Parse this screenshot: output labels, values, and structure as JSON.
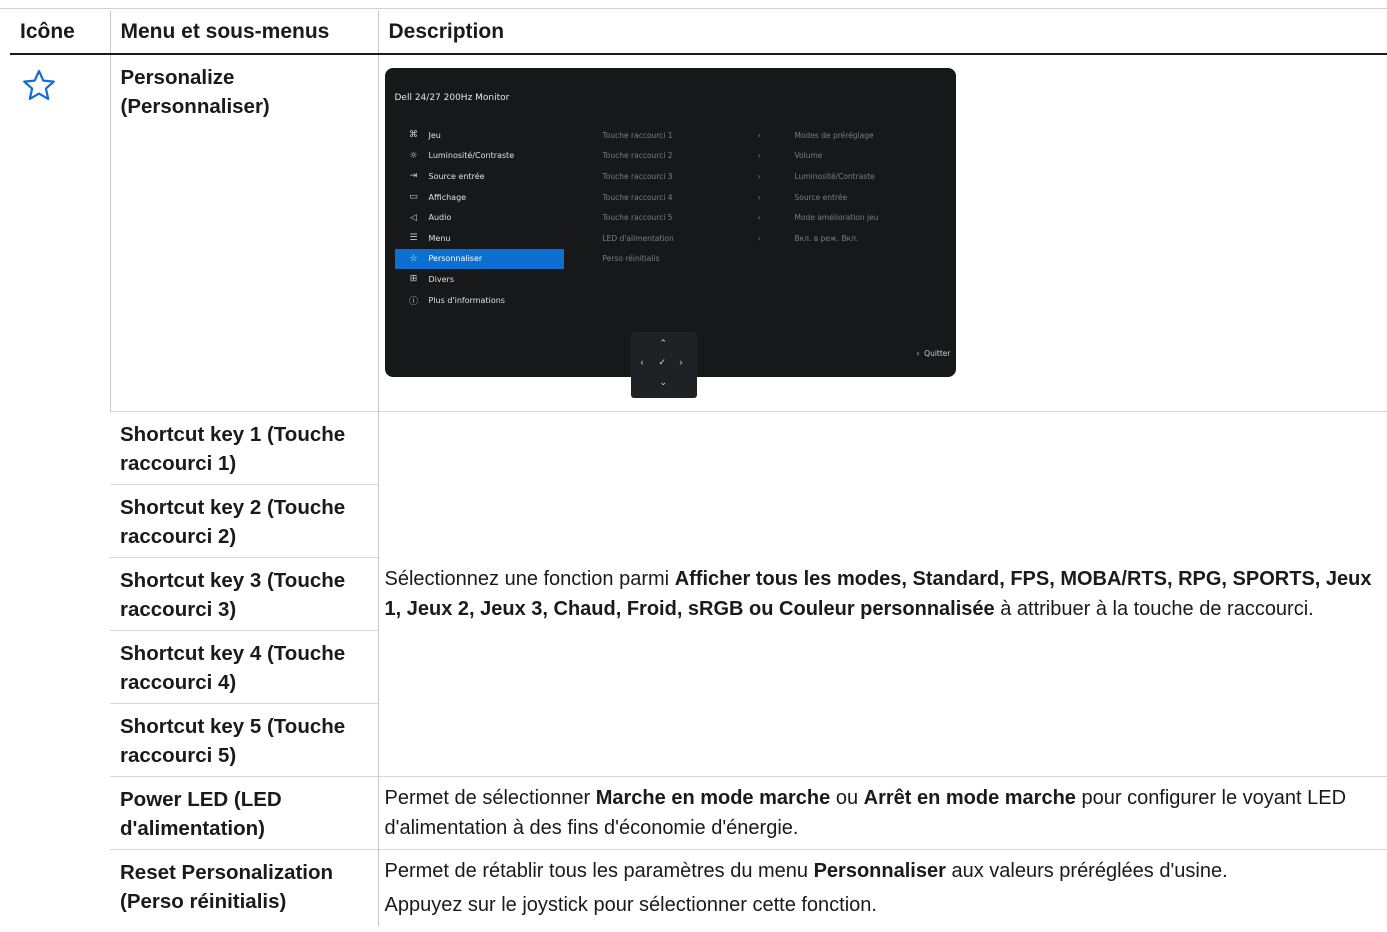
{
  "header": {
    "col_icon": "Icône",
    "col_menu": "Menu et sous-menus",
    "col_desc": "Description"
  },
  "menu_icon": "star-icon",
  "accent_color": "#0d6fd1",
  "rows": {
    "personalize": {
      "label": "Personalize (Personnaliser)"
    },
    "shortcut1": {
      "label": "Shortcut key 1 (Touche raccourci 1)"
    },
    "shortcut2": {
      "label": "Shortcut key 2 (Touche raccourci 2)"
    },
    "shortcut3": {
      "label": "Shortcut key 3 (Touche raccourci 3)"
    },
    "shortcut4": {
      "label": "Shortcut key 4 (Touche raccourci 4)"
    },
    "shortcut5": {
      "label": "Shortcut key 5 (Touche raccourci 5)"
    },
    "power_led": {
      "label": "Power LED (LED d'alimentation)"
    },
    "reset": {
      "label": "Reset Personalization (Perso réinitialis)"
    }
  },
  "desc_shortcut": {
    "before": "Sélectionnez une fonction parmi ",
    "bold": "Afficher tous les modes, Standard, FPS, MOBA/RTS, RPG, SPORTS, Jeux 1, Jeux 2, Jeux 3, Chaud, Froid, sRGB ou Couleur personnalisée",
    "after": " à attribuer à la touche de raccourci."
  },
  "desc_power": {
    "p1": "Permet de sélectionner ",
    "b1": "Marche en mode marche",
    "p2": " ou ",
    "b2": "Arrêt en mode marche",
    "p3": " pour configurer le voyant LED d'alimentation à des fins d'économie d'énergie."
  },
  "desc_reset": {
    "p1": "Permet de rétablir tous les paramètres du menu ",
    "b1": "Personnaliser",
    "p2": " aux valeurs préréglées d'usine.",
    "line2": "Appuyez sur le joystick pour sélectionner cette fonction."
  },
  "osd": {
    "title": "Dell 24/27 200Hz Monitor",
    "menu": [
      {
        "label": "Jeu",
        "icon": "gamepad-icon",
        "glyph": "⌘"
      },
      {
        "label": "Luminosité/Contraste",
        "icon": "brightness-icon",
        "glyph": "☼"
      },
      {
        "label": "Source entrée",
        "icon": "input-source-icon",
        "glyph": "⇥"
      },
      {
        "label": "Affichage",
        "icon": "display-icon",
        "glyph": "▭"
      },
      {
        "label": "Audio",
        "icon": "speaker-icon",
        "glyph": "◁"
      },
      {
        "label": "Menu",
        "icon": "menu-icon",
        "glyph": "☰"
      },
      {
        "label": "Personnaliser",
        "icon": "star-icon",
        "glyph": "☆"
      },
      {
        "label": "Divers",
        "icon": "misc-icon",
        "glyph": "⊞"
      },
      {
        "label": "Plus d'informations",
        "icon": "info-icon",
        "glyph": "ⓘ"
      }
    ],
    "submenu": [
      "Touche raccourci 1",
      "Touche raccourci 2",
      "Touche raccourci 3",
      "Touche raccourci 4",
      "Touche raccourci 5",
      "LED d'alimentation",
      "Perso réinitialis"
    ],
    "values": [
      "Modes de préréglage",
      "Volume",
      "Luminosité/Contraste",
      "Source entrée",
      "Mode amélioration jeu",
      "Вкл. в реж. Вкл."
    ],
    "exit": "Quitter",
    "active_index": 6
  }
}
